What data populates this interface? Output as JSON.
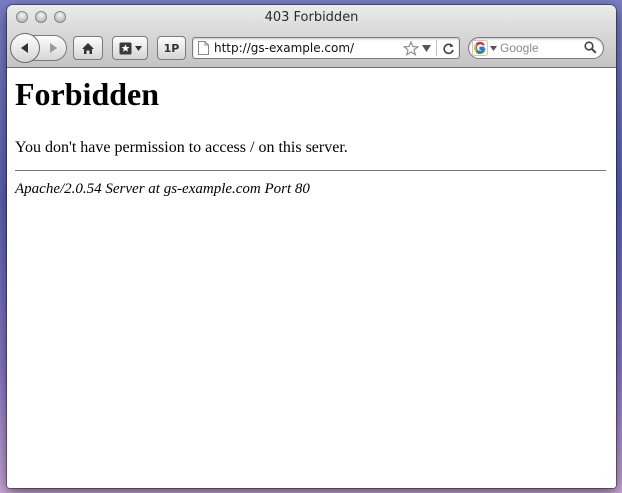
{
  "window": {
    "title": "403 Forbidden"
  },
  "toolbar": {
    "back_icon": "back-arrow-icon",
    "forward_icon": "forward-arrow-icon",
    "home_icon": "home-icon",
    "bookmarks_icon": "bookmark-star-icon",
    "onepassword_label": "1P",
    "url": "http://gs-example.com/",
    "search_placeholder": "Google",
    "search_engine_icon": "google-icon"
  },
  "page": {
    "heading": "Forbidden",
    "message": "You don't have permission to access / on this server.",
    "address": "Apache/2.0.54 Server at gs-example.com Port 80"
  }
}
